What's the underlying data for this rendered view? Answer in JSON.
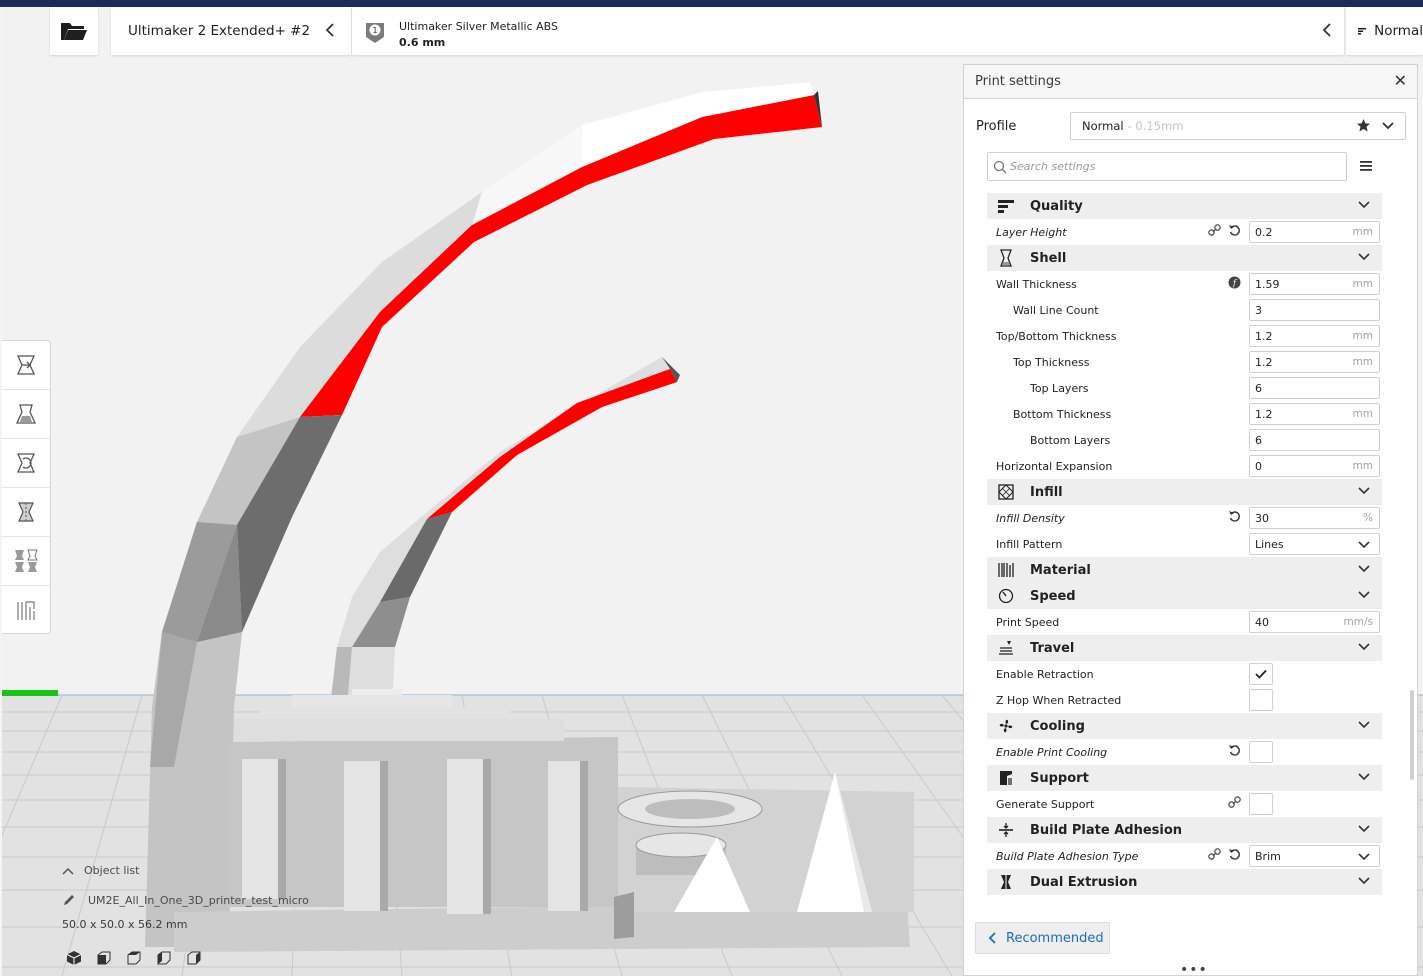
{
  "header": {
    "printer_name": "Ultimaker 2 Extended+ #2",
    "extruder_number": "1",
    "material_name": "Ultimaker Silver Metallic ABS",
    "nozzle_size": "0.6 mm",
    "profile_button_label": "Normal"
  },
  "toolbar": {
    "tools": [
      "move-icon",
      "scale-icon",
      "rotate-icon",
      "mirror-icon",
      "per-model-settings-icon",
      "support-blocker-icon"
    ]
  },
  "object_info": {
    "object_list_label": "Object list",
    "object_name": "UM2E_All_In_One_3D_printer_test_micro",
    "dimensions": "50.0 x 50.0 x 56.2 mm"
  },
  "print_settings": {
    "title": "Print settings",
    "profile_label": "Profile",
    "profile_value": "Normal",
    "profile_subvalue": "- 0.15mm",
    "search_placeholder": "Search settings",
    "recommended_label": "Recommended",
    "categories": {
      "quality": "Quality",
      "shell": "Shell",
      "infill": "Infill",
      "material": "Material",
      "speed": "Speed",
      "travel": "Travel",
      "cooling": "Cooling",
      "support": "Support",
      "adhesion": "Build Plate Adhesion",
      "dual": "Dual Extrusion"
    },
    "settings": {
      "layer_height": {
        "label": "Layer Height",
        "value": "0.2",
        "unit": "mm"
      },
      "wall_thickness": {
        "label": "Wall Thickness",
        "value": "1.59",
        "unit": "mm"
      },
      "wall_line_count": {
        "label": "Wall Line Count",
        "value": "3"
      },
      "top_bottom_thickness": {
        "label": "Top/Bottom Thickness",
        "value": "1.2",
        "unit": "mm"
      },
      "top_thickness": {
        "label": "Top Thickness",
        "value": "1.2",
        "unit": "mm"
      },
      "top_layers": {
        "label": "Top Layers",
        "value": "6"
      },
      "bottom_thickness": {
        "label": "Bottom Thickness",
        "value": "1.2",
        "unit": "mm"
      },
      "bottom_layers": {
        "label": "Bottom Layers",
        "value": "6"
      },
      "horizontal_expansion": {
        "label": "Horizontal Expansion",
        "value": "0",
        "unit": "mm"
      },
      "infill_density": {
        "label": "Infill Density",
        "value": "30",
        "unit": "%"
      },
      "infill_pattern": {
        "label": "Infill Pattern",
        "value": "Lines"
      },
      "print_speed": {
        "label": "Print Speed",
        "value": "40",
        "unit": "mm/s"
      },
      "enable_retraction": {
        "label": "Enable Retraction",
        "checked": true
      },
      "z_hop": {
        "label": "Z Hop When Retracted",
        "checked": false
      },
      "enable_print_cooling": {
        "label": "Enable Print Cooling",
        "checked": false
      },
      "generate_support": {
        "label": "Generate Support",
        "checked": false
      },
      "adhesion_type": {
        "label": "Build Plate Adhesion Type",
        "value": "Brim"
      }
    }
  },
  "colors": {
    "overhang_red": "#ff0000",
    "link_blue": "#1c6bc5",
    "header_band": "#1b2a58"
  }
}
